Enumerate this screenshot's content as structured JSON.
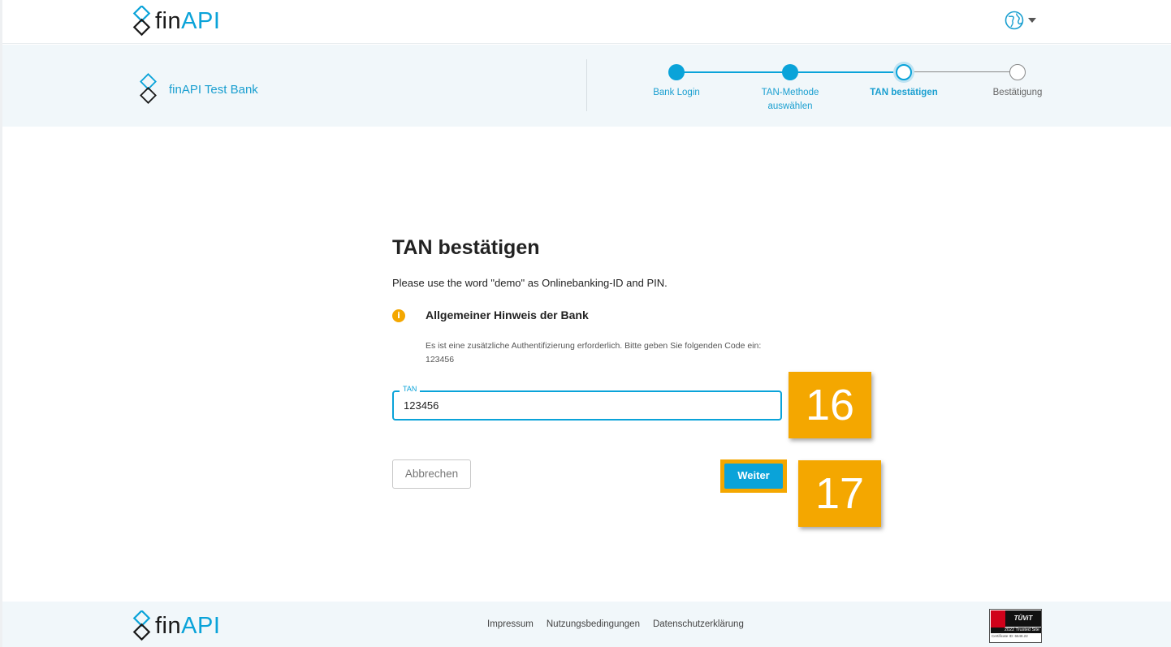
{
  "header": {
    "logo": {
      "part1": "fin",
      "part2": "API"
    },
    "language_icon": "globe-icon"
  },
  "bank": {
    "name": "finAPI Test Bank"
  },
  "stepper": {
    "steps": [
      {
        "label": "Bank Login",
        "state": "done"
      },
      {
        "label": "TAN-Methode auswählen",
        "state": "done"
      },
      {
        "label": "TAN bestätigen",
        "state": "current"
      },
      {
        "label": "Bestätigung",
        "state": "todo"
      }
    ]
  },
  "main": {
    "title": "TAN bestätigen",
    "description": "Please use the word \"demo\" as Onlinebanking-ID and PIN.",
    "notice": {
      "icon": "info-icon",
      "title": "Allgemeiner Hinweis der Bank",
      "text": "Es ist eine zusätzliche Authentifizierung erforderlich. Bitte geben Sie folgenden Code ein: 123456"
    },
    "tan_field": {
      "label": "TAN",
      "value": "123456"
    },
    "cancel_label": "Abbrechen",
    "submit_label": "Weiter"
  },
  "annotations": {
    "badge_a": "16",
    "badge_b": "17"
  },
  "footer": {
    "logo": {
      "part1": "fin",
      "part2": "API"
    },
    "links": [
      "Impressum",
      "Nutzungsbedingungen",
      "Datenschutzerklärung"
    ],
    "seal": {
      "brand": "TÜViT",
      "caption": "2022 Trusted Site",
      "sub": "Certificate ID: 6648.22"
    }
  },
  "colors": {
    "accent": "#0aa3d9",
    "highlight": "#f4a700",
    "band": "#f1f7fa"
  }
}
